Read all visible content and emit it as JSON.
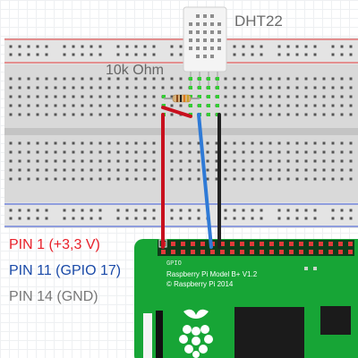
{
  "sensor": {
    "name": "DHT22"
  },
  "resistor": {
    "label": "10k Ohm"
  },
  "pins": [
    {
      "label": "PIN 1 (+3,3 V)",
      "color": "#e8202a"
    },
    {
      "label": "PIN 11 (GPIO 17)",
      "color": "#1a4aa8"
    },
    {
      "label": "PIN 14 (GND)",
      "color": "#777777"
    }
  ],
  "board": {
    "gpio_label": "GPIO",
    "model": "Raspberry Pi Model B+ V1.2",
    "copyright": "© Raspberry Pi 2014"
  },
  "wires": [
    {
      "name": "power",
      "color": "#c8101e"
    },
    {
      "name": "data",
      "color": "#2f7ad6"
    },
    {
      "name": "ground",
      "color": "#222222"
    }
  ],
  "colors": {
    "breadboard": "#d9d9d9",
    "rail_red": "#e23a3a",
    "rail_blue": "#3a56d6",
    "pcb": "#17a536",
    "sensor_body": "#f2f2f2"
  }
}
